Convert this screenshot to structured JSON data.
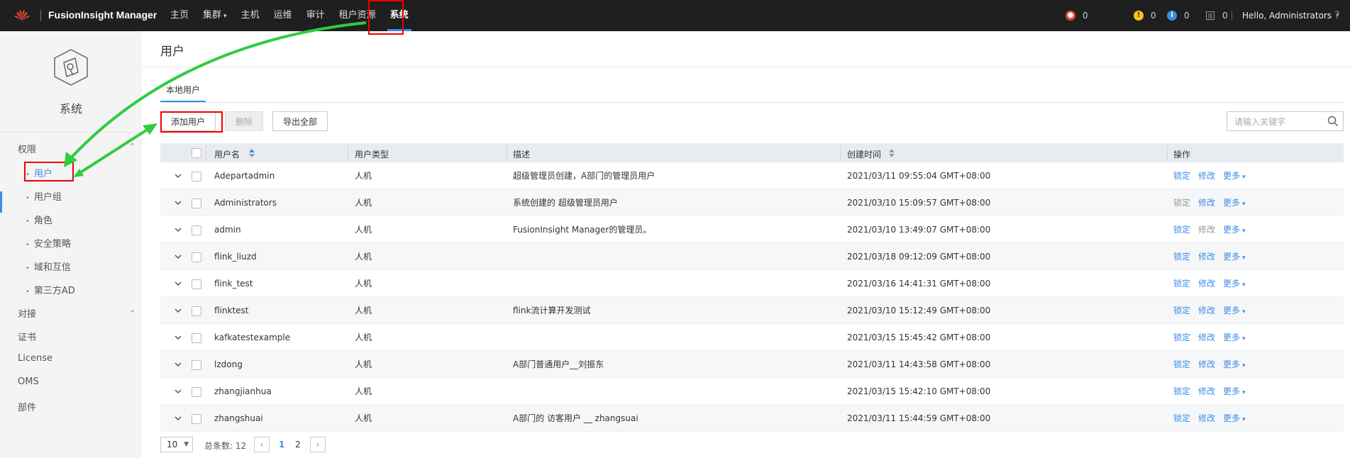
{
  "topbar": {
    "app_title": "FusionInsight Manager",
    "nav": [
      {
        "label": "主页",
        "has_caret": false
      },
      {
        "label": "集群",
        "has_caret": true
      },
      {
        "label": "主机",
        "has_caret": false
      },
      {
        "label": "运维",
        "has_caret": false
      },
      {
        "label": "审计",
        "has_caret": false
      },
      {
        "label": "租户资源",
        "has_caret": false
      },
      {
        "label": "系统",
        "has_caret": false,
        "active": true
      }
    ],
    "stats": {
      "critical": "0",
      "major": "0",
      "minor": "0",
      "tasks": "0"
    },
    "user_greeting": "Hello, Administrators",
    "help": "?",
    "colors": {
      "critical": "#e8453c",
      "major": "#f5c518",
      "minor": "#3a8ee6"
    }
  },
  "sidebar": {
    "section_title": "系统",
    "groups": [
      {
        "label": "权限",
        "expanded": true,
        "items": [
          "用户",
          "用户组",
          "角色",
          "安全策略",
          "域和互信",
          "第三方AD"
        ]
      },
      {
        "label": "对接",
        "expanded": false
      },
      {
        "label": "证书"
      },
      {
        "label": "License"
      },
      {
        "label": "OMS"
      },
      {
        "label": "部件"
      }
    ],
    "active_item": "用户"
  },
  "main": {
    "page_title": "用户",
    "tab": "本地用户",
    "buttons": {
      "add": "添加用户",
      "delete": "删除",
      "export": "导出全部"
    },
    "search_placeholder": "请输入关键字",
    "columns": [
      "用户名",
      "用户类型",
      "描述",
      "创建时间",
      "操作"
    ],
    "rows": [
      {
        "name": "Adepartadmin",
        "type": "人机",
        "desc": "超级管理员创建，A部门的管理员用户",
        "created": "2021/03/11 09:55:04 GMT+08:00",
        "lock_enabled": true,
        "edit_enabled": true
      },
      {
        "name": "Administrators",
        "type": "人机",
        "desc": "系统创建的 超级管理员用户",
        "created": "2021/03/10 15:09:57 GMT+08:00",
        "lock_enabled": false,
        "edit_enabled": true
      },
      {
        "name": "admin",
        "type": "人机",
        "desc": "FusionInsight Manager的管理员。",
        "created": "2021/03/10 13:49:07 GMT+08:00",
        "lock_enabled": true,
        "edit_enabled": false
      },
      {
        "name": "flink_liuzd",
        "type": "人机",
        "desc": "",
        "created": "2021/03/18 09:12:09 GMT+08:00",
        "lock_enabled": true,
        "edit_enabled": true
      },
      {
        "name": "flink_test",
        "type": "人机",
        "desc": "",
        "created": "2021/03/16 14:41:31 GMT+08:00",
        "lock_enabled": true,
        "edit_enabled": true
      },
      {
        "name": "flinktest",
        "type": "人机",
        "desc": "flink流计算开发测试",
        "created": "2021/03/10 15:12:49 GMT+08:00",
        "lock_enabled": true,
        "edit_enabled": true
      },
      {
        "name": "kafkatestexample",
        "type": "人机",
        "desc": "",
        "created": "2021/03/15 15:45:42 GMT+08:00",
        "lock_enabled": true,
        "edit_enabled": true
      },
      {
        "name": "lzdong",
        "type": "人机",
        "desc": "A部门普通用户__刘振东",
        "created": "2021/03/11 14:43:58 GMT+08:00",
        "lock_enabled": true,
        "edit_enabled": true
      },
      {
        "name": "zhangjianhua",
        "type": "人机",
        "desc": "",
        "created": "2021/03/15 15:42:10 GMT+08:00",
        "lock_enabled": true,
        "edit_enabled": true
      },
      {
        "name": "zhangshuai",
        "type": "人机",
        "desc": "A部门的 访客用户 __ zhangsuai",
        "created": "2021/03/11 15:44:59 GMT+08:00",
        "lock_enabled": true,
        "edit_enabled": true
      }
    ],
    "ops": {
      "lock": "锁定",
      "edit": "修改",
      "more": "更多"
    },
    "pagination": {
      "page_size": "10",
      "total_label": "总条数: 12",
      "pages": [
        "1",
        "2"
      ],
      "current": "1"
    }
  },
  "annotations": {
    "box_color": "#e00000",
    "arrow_color": "#2ecc40"
  }
}
